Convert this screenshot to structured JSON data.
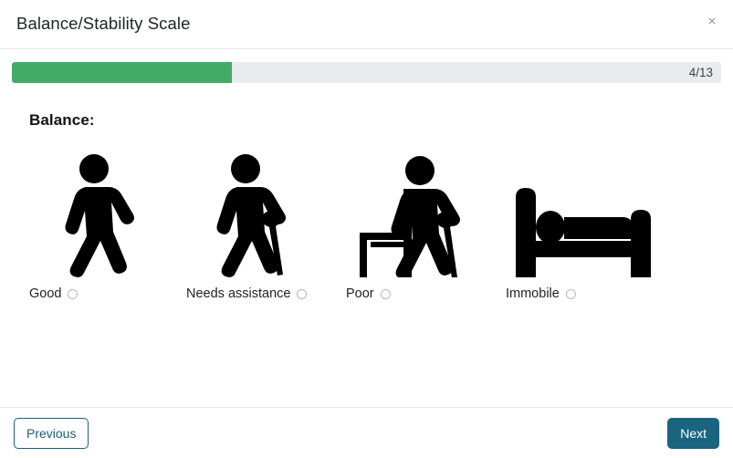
{
  "modal": {
    "title": "Balance/Stability Scale",
    "close_label": "×"
  },
  "progress": {
    "current": 4,
    "total": 13,
    "label": "4/13",
    "percent": 31,
    "fill_color": "#42ab68",
    "track_color": "#e9ecef"
  },
  "question": {
    "label": "Balance:",
    "options": [
      {
        "label": "Good",
        "icon": "walking-person-icon",
        "selected": false
      },
      {
        "label": "Needs assistance",
        "icon": "person-with-cane-icon",
        "selected": false
      },
      {
        "label": "Poor",
        "icon": "person-with-cane-and-chair-icon",
        "selected": false
      },
      {
        "label": "Immobile",
        "icon": "person-in-bed-icon",
        "selected": false
      }
    ]
  },
  "footer": {
    "previous_label": "Previous",
    "next_label": "Next",
    "previous_color": "#1c6079",
    "next_color": "#1a6480"
  }
}
